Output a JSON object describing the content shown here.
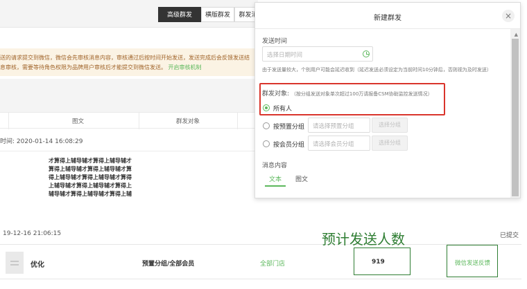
{
  "tabs": [
    {
      "label": "高级群发",
      "active": true
    },
    {
      "label": "横版群发",
      "active": false
    },
    {
      "label": "群发消",
      "active": false
    }
  ],
  "notice": {
    "line1": "送的请求提交到微信，微信会先审核消息内容，审核通过后按时间开始发送，发送完成后会反馈发送结",
    "line2": "息审核，需要等待角色权限为品牌用户审核后才能提交到微信发送。",
    "link": "开启审核机制"
  },
  "table": {
    "headers": [
      "图文",
      "群发对象"
    ]
  },
  "record": {
    "time_label": "时间:",
    "time_value": "2020-01-14 16:08:29",
    "text_lines": [
      "才算得上辅导辅才算得上辅导辅才",
      "算得上辅导辅才算得上辅导辅才算",
      "得上辅导辅才算得上辅导辅才算得",
      "上辅导辅才算得上辅导辅才算得上",
      "辅导辅才算得上辅导辅才算得上辅"
    ]
  },
  "modal": {
    "title": "新建群发",
    "close_label": "×",
    "send_time_label": "发送时间",
    "send_time_placeholder": "选择日期时间",
    "send_time_hint": "由于发送量较大，个别用户可能会延迟收到（延迟发送必须设定为当前时间10分钟后，否则视为及时发送）",
    "target_label": "群发对象:",
    "target_hint": "（按分组发送对象单次超过100万请报备CSM协助监控发送情况）",
    "options": [
      {
        "label": "所有人",
        "checked": true
      },
      {
        "label": "按预置分组",
        "placeholder": "请选择预置分组",
        "button": "选择分组",
        "checked": false
      },
      {
        "label": "按会员分组",
        "placeholder": "请选择会员分组",
        "button": "选择分组",
        "checked": false
      }
    ],
    "content_label": "消息内容",
    "content_tabs": [
      {
        "label": "文本",
        "active": true
      },
      {
        "label": "图文",
        "active": false
      }
    ],
    "accent_color": "#5cb85c",
    "highlight_color": "#d9342b"
  },
  "bottom": {
    "date": "19-12-16 21:06:15",
    "status": "已提交",
    "name": "优化",
    "target": "预置分组/全部会员",
    "store": "全部门店",
    "count": "919",
    "feedback": "微信发送反馈",
    "annotation": "预计发送人数"
  }
}
